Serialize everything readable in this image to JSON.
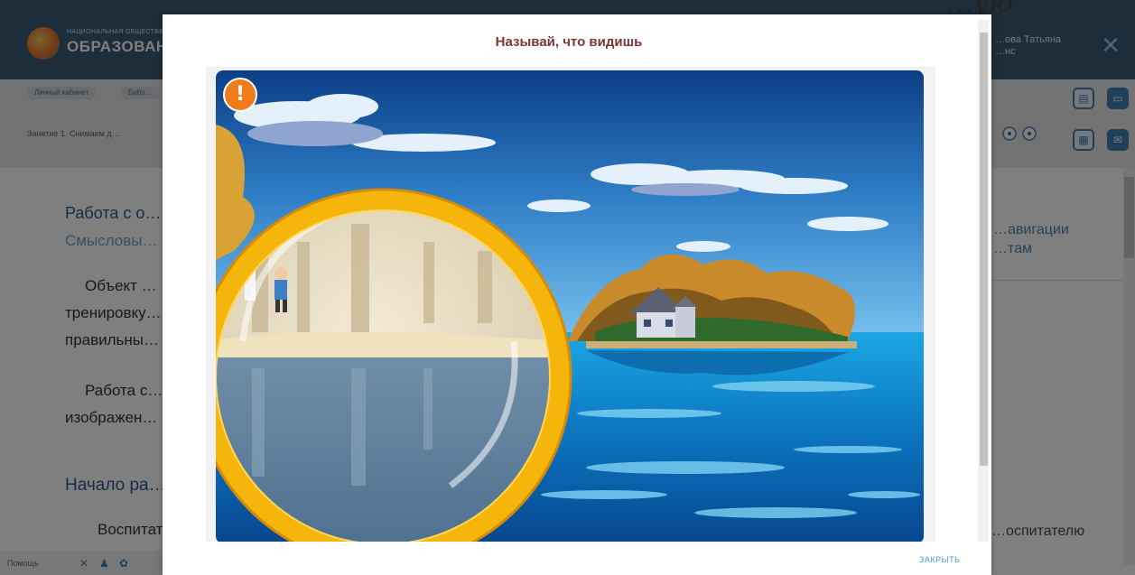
{
  "background": {
    "brand_small": "НАЦИОНАЛЬНАЯ ОБЩЕСТВЕННАЯ",
    "brand": "ОБРАЗОВАНИЕ",
    "user_name": "…ова Татьяна",
    "user_role": "…нс",
    "close_icon": "×",
    "crumbs": [
      "Личный кабинет",
      "Библ…"
    ],
    "lesson_select": "Занятие 1. Снимаем д…",
    "section_title": "Работа с о…",
    "section_subtitle": "Смысловы…",
    "paragraph_1": [
      "Объект …",
      "тренировку…",
      "правильны…"
    ],
    "paragraph_2": [
      "Работа с…",
      "изображен…"
    ],
    "start_heading": "Начало ра…",
    "start_text": "Воспитат…",
    "right_panel_text": "…авигации\n…там",
    "right_bottom_text": "…оспитателю",
    "help_label": "Помощь",
    "social_icons": [
      "✕",
      "♟",
      "✿"
    ],
    "corner_note": "…ую"
  },
  "modal": {
    "title": "Называй, что видишь",
    "close_label": "ЗАКРЫТЬ",
    "alert_icon": "exclamation-icon",
    "alert_mark": "!"
  },
  "colors": {
    "header": "#3b5a74",
    "title": "#7d3636",
    "link": "#4b9ad6",
    "lens_ring": "#f5b50a",
    "alert": "#f07b1a"
  }
}
